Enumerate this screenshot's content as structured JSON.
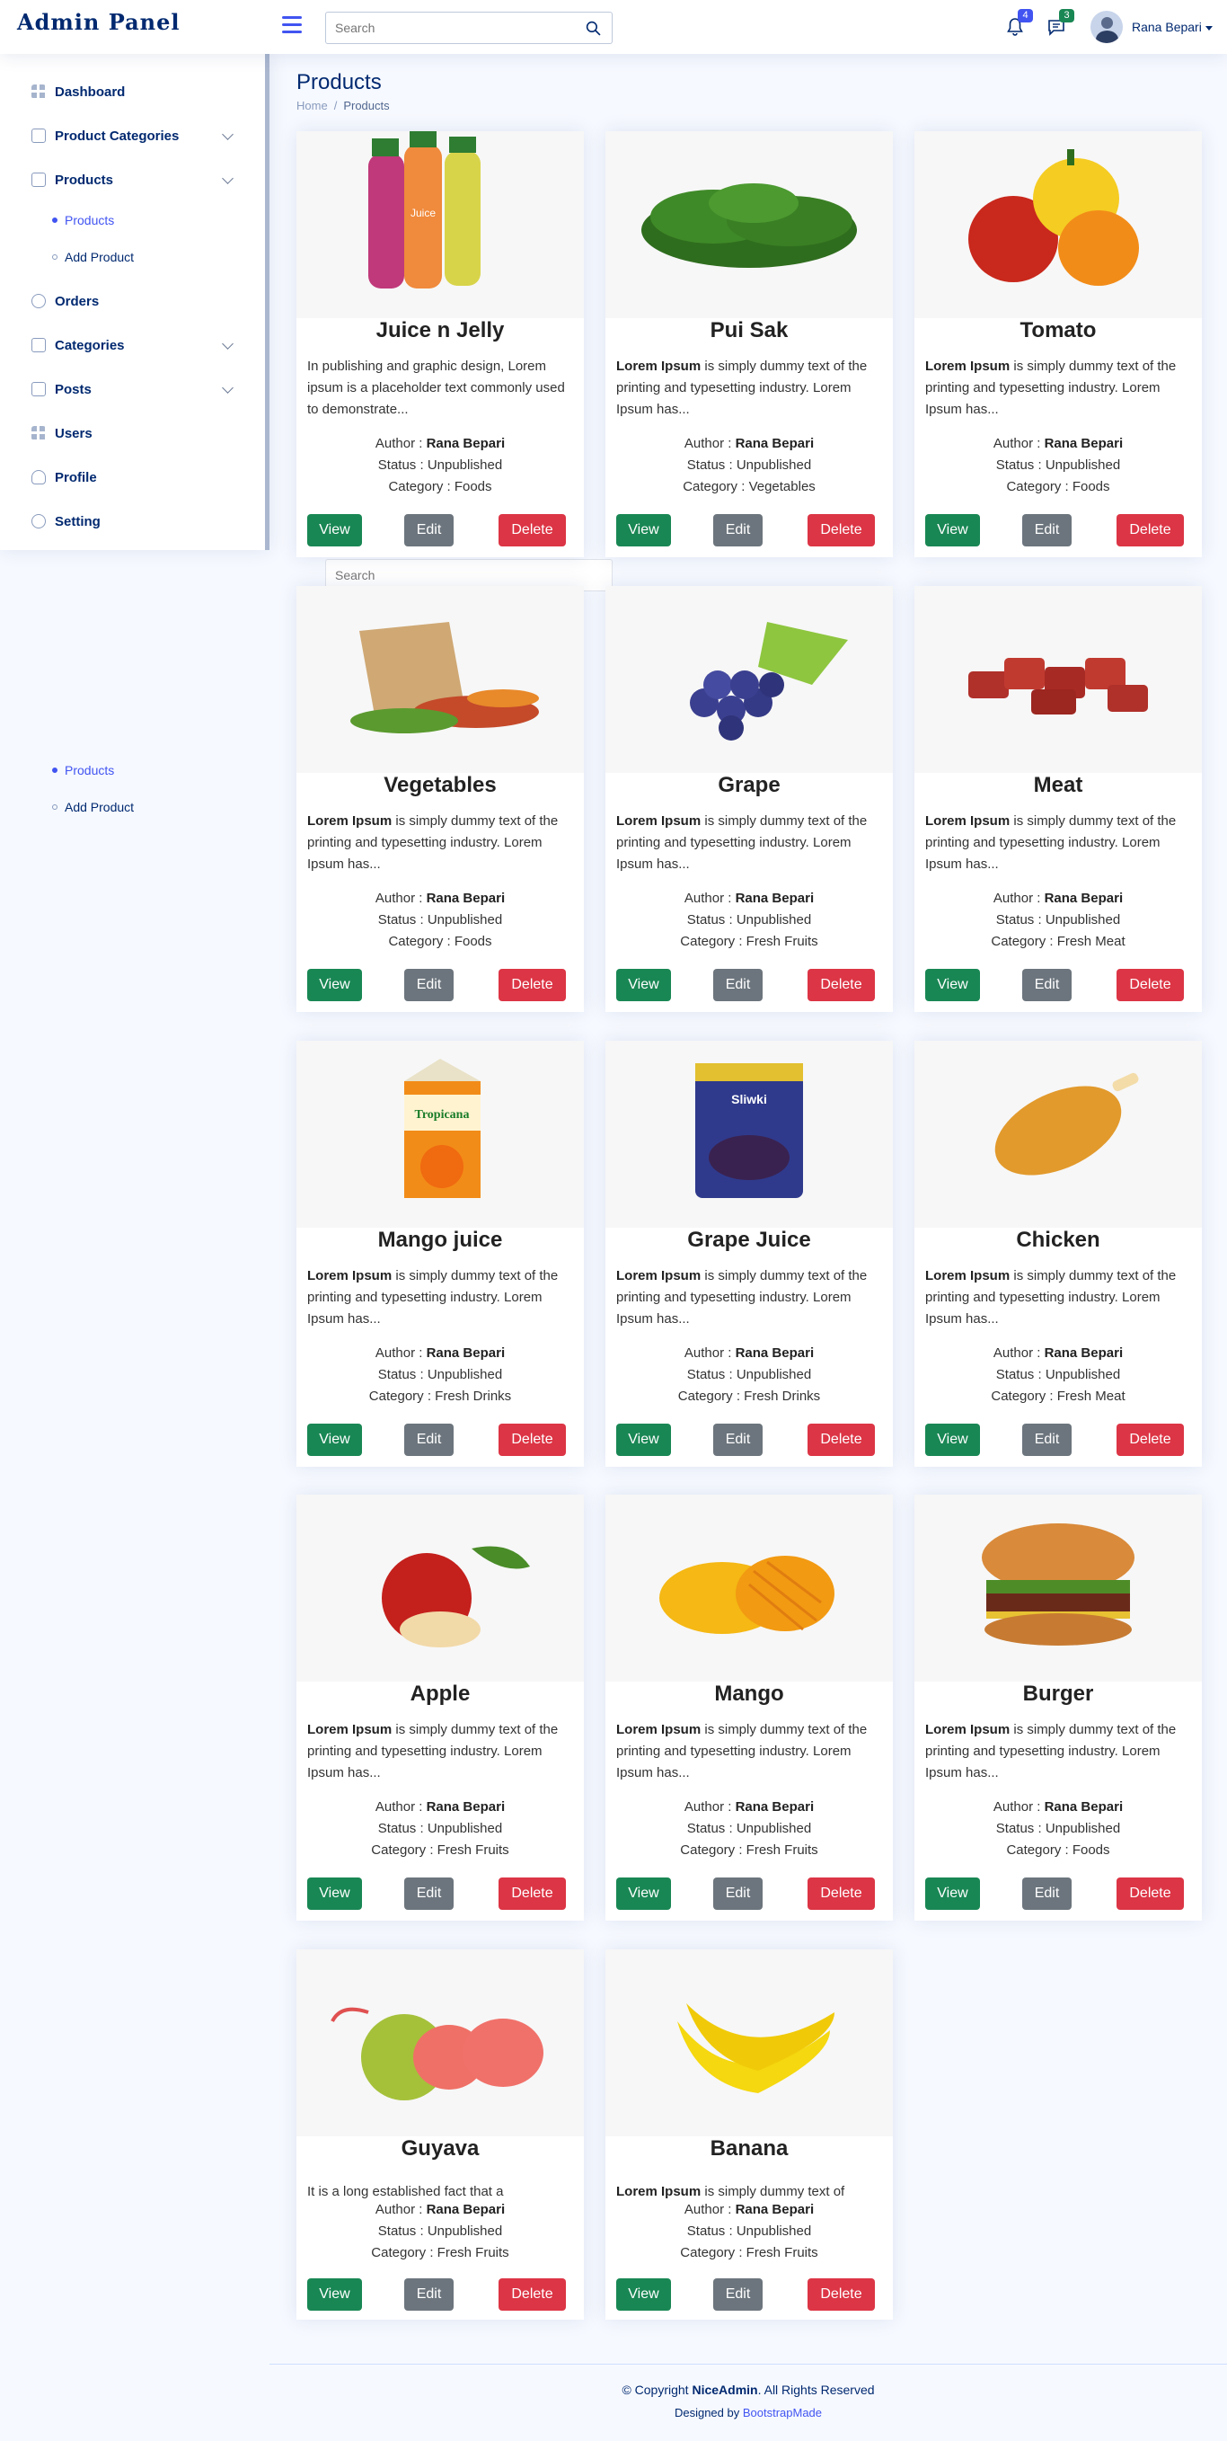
{
  "header": {
    "logo": "Admin Panel",
    "search_placeholder": "Search",
    "notifications_count": "4",
    "messages_count": "3",
    "user_name": "Rana Bepari"
  },
  "sidebar": {
    "items": [
      {
        "label": "Dashboard",
        "icon": "grid-icon"
      },
      {
        "label": "Product Categories",
        "icon": "layout-icon"
      },
      {
        "label": "Products",
        "icon": "journal-icon"
      },
      {
        "label": "Orders",
        "icon": "circle-icon"
      },
      {
        "label": "Categories",
        "icon": "layout-icon"
      },
      {
        "label": "Posts",
        "icon": "layout-icon"
      },
      {
        "label": "Users",
        "icon": "grid-icon"
      },
      {
        "label": "Profile",
        "icon": "person-icon"
      },
      {
        "label": "Setting",
        "icon": "circle-icon"
      }
    ],
    "products_sub": [
      "Products",
      "Add Product"
    ],
    "ghost_sub": [
      "Products",
      "Add Product"
    ],
    "ghost_search_placeholder": "Search"
  },
  "page": {
    "title": "Products",
    "breadcrumb_home": "Home",
    "breadcrumb_sep": "/",
    "breadcrumb_current": "Products"
  },
  "labels": {
    "author": "Author : ",
    "status": "Status : ",
    "category": "Category : ",
    "view": "View",
    "edit": "Edit",
    "delete": "Delete"
  },
  "products": [
    {
      "name": "Juice n Jelly",
      "desc_bold": "",
      "desc": "In publishing and graphic design, Lorem ipsum is a placeholder text commonly used to demonstrate...",
      "author": "Rana Bepari",
      "status": "Unpublished",
      "category": "Foods",
      "image": "juice-bottles"
    },
    {
      "name": "Pui Sak",
      "desc_bold": "Lorem Ipsum",
      "desc": " is simply dummy text of the printing and typesetting industry. Lorem Ipsum has...",
      "author": "Rana Bepari",
      "status": "Unpublished",
      "category": "Vegetables",
      "image": "spinach"
    },
    {
      "name": "Tomato",
      "desc_bold": "Lorem Ipsum",
      "desc": " is simply dummy text of the printing and typesetting industry. Lorem Ipsum has...",
      "author": "Rana Bepari",
      "status": "Unpublished",
      "category": "Foods",
      "image": "peppers"
    },
    {
      "name": "Vegetables",
      "desc_bold": "Lorem Ipsum",
      "desc": " is simply dummy text of the printing and typesetting industry. Lorem Ipsum has...",
      "author": "Rana Bepari",
      "status": "Unpublished",
      "category": "Foods",
      "image": "veg-bag"
    },
    {
      "name": "Grape",
      "desc_bold": "Lorem Ipsum",
      "desc": " is simply dummy text of the printing and typesetting industry. Lorem Ipsum has...",
      "author": "Rana Bepari",
      "status": "Unpublished",
      "category": "Fresh Fruits",
      "image": "grapes"
    },
    {
      "name": "Meat",
      "desc_bold": "Lorem Ipsum",
      "desc": " is simply dummy text of the printing and typesetting industry. Lorem Ipsum has...",
      "author": "Rana Bepari",
      "status": "Unpublished",
      "category": "Fresh Meat",
      "image": "meat"
    },
    {
      "name": "Mango juice",
      "desc_bold": "Lorem Ipsum",
      "desc": " is simply dummy text of the printing and typesetting industry. Lorem Ipsum has...",
      "author": "Rana Bepari",
      "status": "Unpublished",
      "category": "Fresh Drinks",
      "image": "tropicana"
    },
    {
      "name": "Grape Juice",
      "desc_bold": "Lorem Ipsum",
      "desc": " is simply dummy text of the printing and typesetting industry. Lorem Ipsum has...",
      "author": "Rana Bepari",
      "status": "Unpublished",
      "category": "Fresh Drinks",
      "image": "prunes-pack"
    },
    {
      "name": "Chicken",
      "desc_bold": "Lorem Ipsum",
      "desc": " is simply dummy text of the printing and typesetting industry. Lorem Ipsum has...",
      "author": "Rana Bepari",
      "status": "Unpublished",
      "category": "Fresh Meat",
      "image": "chicken-leg"
    },
    {
      "name": "Apple",
      "desc_bold": "Lorem Ipsum",
      "desc": " is simply dummy text of the printing and typesetting industry. Lorem Ipsum has...",
      "author": "Rana Bepari",
      "status": "Unpublished",
      "category": "Fresh Fruits",
      "image": "apple"
    },
    {
      "name": "Mango",
      "desc_bold": "Lorem Ipsum",
      "desc": " is simply dummy text of the printing and typesetting industry. Lorem Ipsum has...",
      "author": "Rana Bepari",
      "status": "Unpublished",
      "category": "Fresh Fruits",
      "image": "mango"
    },
    {
      "name": "Burger",
      "desc_bold": "Lorem Ipsum",
      "desc": " is simply dummy text of the printing and typesetting industry. Lorem Ipsum has...",
      "author": "Rana Bepari",
      "status": "Unpublished",
      "category": "Foods",
      "image": "burger"
    },
    {
      "name": "Guyava",
      "desc_bold": "",
      "desc": "It is a long established fact that a",
      "author": "Rana Bepari",
      "status": "Unpublished",
      "category": "Fresh Fruits",
      "image": "guava"
    },
    {
      "name": "Banana",
      "desc_bold": "Lorem Ipsum",
      "desc": " is simply dummy text of",
      "author": "Rana Bepari",
      "status": "Unpublished",
      "category": "Fresh Fruits",
      "image": "banana"
    }
  ],
  "footer": {
    "copyright_prefix": "© Copyright ",
    "brand": "NiceAdmin",
    "copyright_suffix": ". All Rights Reserved",
    "designed_by": "Designed by ",
    "designer": "BootstrapMade"
  },
  "colors": {
    "accent": "#4154f1",
    "navy": "#012970",
    "view": "#198754",
    "edit": "#6c757d",
    "delete": "#dc3545"
  }
}
